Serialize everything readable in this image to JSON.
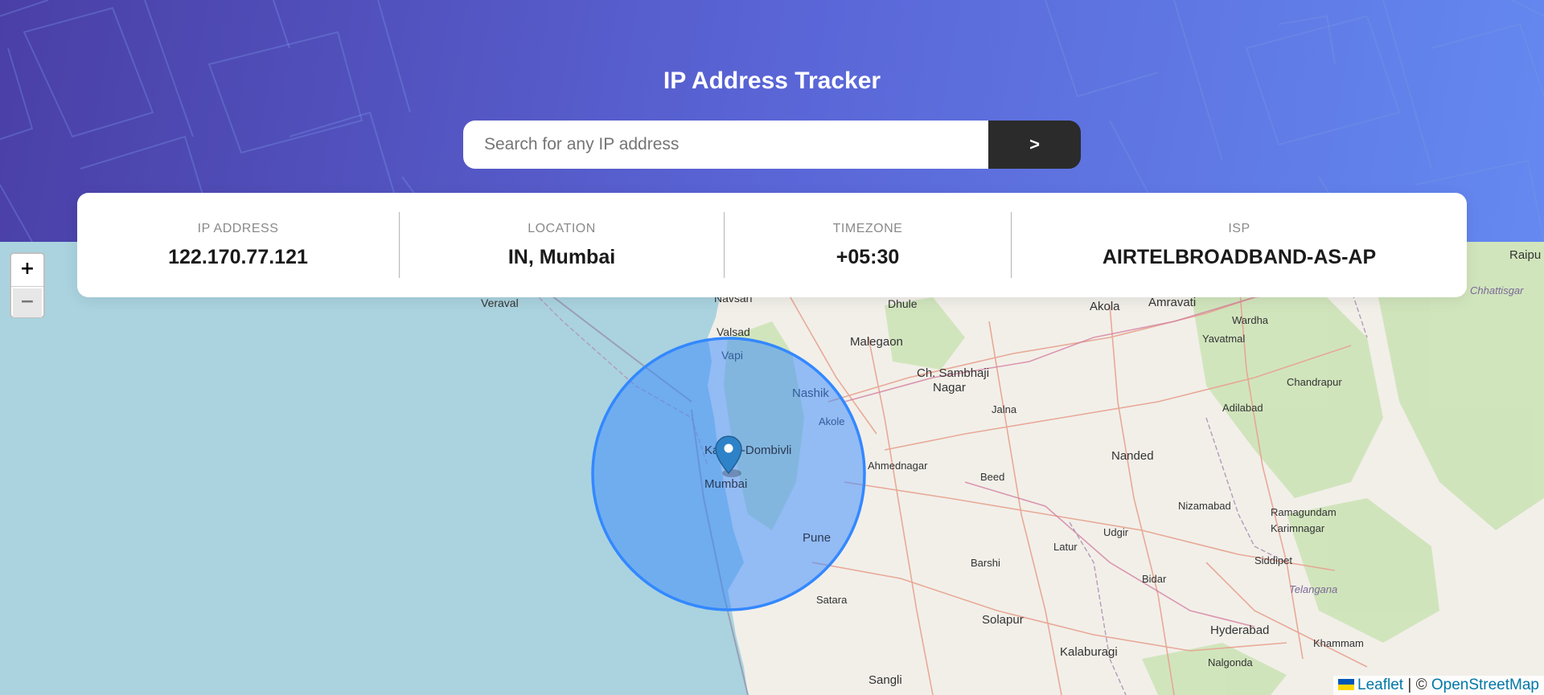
{
  "app": {
    "title": "IP Address Tracker"
  },
  "search": {
    "placeholder": "Search for any IP address",
    "value": "",
    "submit_label": ">"
  },
  "info": {
    "ip": {
      "label": "IP ADDRESS",
      "value": "122.170.77.121"
    },
    "location": {
      "label": "LOCATION",
      "value": "IN, Mumbai"
    },
    "timezone": {
      "label": "TIMEZONE",
      "value": "+05:30"
    },
    "isp": {
      "label": "ISP",
      "value": "AIRTELBROADBAND-AS-AP"
    }
  },
  "map": {
    "zoom_in": "+",
    "zoom_out": "−",
    "places": {
      "mumbai": "Mumbai",
      "kalyan": "Kalyan-Dombivli",
      "pune": "Pune",
      "nashik": "Nashik",
      "akole": "Akole",
      "vapi": "Vapi",
      "valsad": "Valsad",
      "navsari": "Navsari",
      "satara": "Satara",
      "veraval": "Veraval",
      "malegaon": "Malegaon",
      "dhule": "Dhule",
      "sambhaji1": "Ch. Sambhaji",
      "sambhaji2": "Nagar",
      "jalna": "Jalna",
      "ahmednagar": "Ahmednagar",
      "beed": "Beed",
      "akola": "Akola",
      "amravati": "Amravati",
      "wardha": "Wardha",
      "yavatmal": "Yavatmal",
      "nanded": "Nanded",
      "adilabad": "Adilabad",
      "chandrapur": "Chandrapur",
      "nizamabad": "Nizamabad",
      "udgir": "Udgir",
      "latur": "Latur",
      "ramagundam": "Ramagundam",
      "karimnagar": "Karimnagar",
      "siddipet": "Siddipet",
      "telangana": "Telangana",
      "bidar": "Bidar",
      "barshi": "Barshi",
      "solapur": "Solapur",
      "hyderabad": "Hyderabad",
      "khammam": "Khammam",
      "kalaburagi": "Kalaburagi",
      "nalgonda": "Nalgonda",
      "sangli": "Sangli",
      "raipur": "Raipu",
      "chhattisgarh": "Chhattisgar"
    },
    "circle_color": "#3388ff",
    "water_color": "#aad3df",
    "land_color": "#f2efe9"
  },
  "attribution": {
    "leaflet": "Leaflet",
    "separator": "|",
    "copyright": "©",
    "osm": "OpenStreetMap"
  }
}
